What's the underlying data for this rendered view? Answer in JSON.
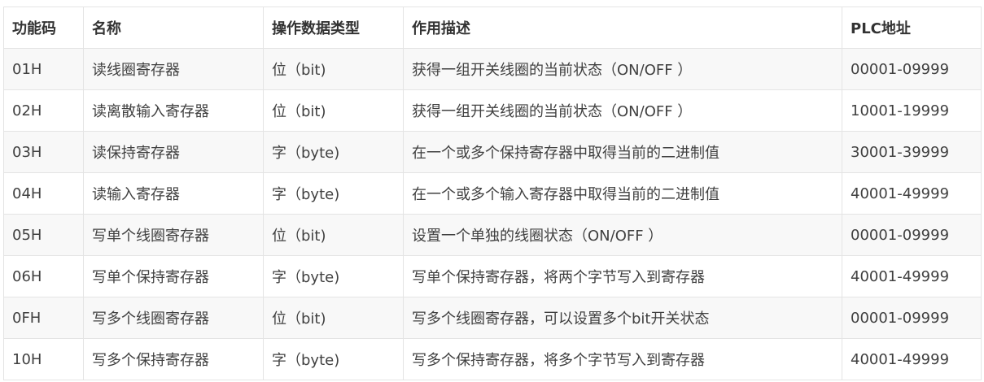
{
  "table": {
    "headers": [
      "功能码",
      "名称",
      "操作数据类型",
      "作用描述",
      "PLC地址"
    ],
    "rows": [
      [
        "01H",
        "读线圈寄存器",
        "位（bit)",
        "获得一组开关线圈的当前状态（ON/OFF ）",
        "00001-09999"
      ],
      [
        "02H",
        "读离散输入寄存器",
        "位（bit)",
        "获得一组开关线圈的当前状态（ON/OFF ）",
        "10001-19999"
      ],
      [
        "03H",
        "读保持寄存器",
        "字（byte)",
        "在一个或多个保持寄存器中取得当前的二进制值",
        "30001-39999"
      ],
      [
        "04H",
        "读输入寄存器",
        "字（byte)",
        "在一个或多个输入寄存器中取得当前的二进制值",
        "40001-49999"
      ],
      [
        "05H",
        "写单个线圈寄存器",
        "位（bit)",
        "设置一个单独的线圈状态（ON/OFF ）",
        "00001-09999"
      ],
      [
        "06H",
        "写单个保持寄存器",
        "字（byte)",
        "写单个保持寄存器，将两个字节写入到寄存器",
        "40001-49999"
      ],
      [
        "0FH",
        "写多个线圈寄存器",
        "位（bit)",
        "写多个线圈寄存器，可以设置多个bit开关状态",
        "00001-09999"
      ],
      [
        "10H",
        "写多个保持寄存器",
        "字（byte)",
        "写多个保持寄存器，将多个字节写入到寄存器",
        "40001-49999"
      ]
    ]
  }
}
